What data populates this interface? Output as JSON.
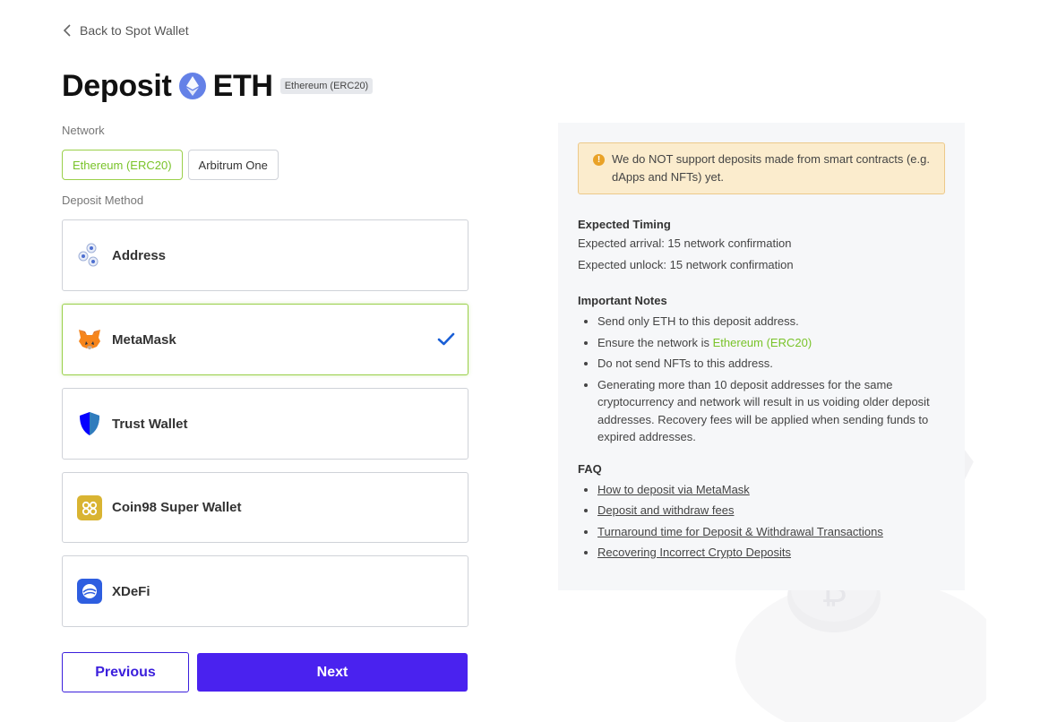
{
  "back": {
    "label": "Back to Spot Wallet"
  },
  "title": {
    "prefix": "Deposit",
    "coin": "ETH",
    "network_tag": "Ethereum (ERC20)"
  },
  "network": {
    "label": "Network",
    "options": [
      {
        "label": "Ethereum (ERC20)",
        "active": true
      },
      {
        "label": "Arbitrum One",
        "active": false
      }
    ]
  },
  "deposit_method": {
    "label": "Deposit Method",
    "options": [
      {
        "label": "Address",
        "icon": "address-icon",
        "selected": false
      },
      {
        "label": "MetaMask",
        "icon": "metamask-icon",
        "selected": true
      },
      {
        "label": "Trust Wallet",
        "icon": "trust-wallet-icon",
        "selected": false
      },
      {
        "label": "Coin98 Super Wallet",
        "icon": "coin98-icon",
        "selected": false
      },
      {
        "label": "XDeFi",
        "icon": "xdefi-icon",
        "selected": false
      }
    ]
  },
  "buttons": {
    "previous": "Previous",
    "next": "Next"
  },
  "info": {
    "warning": "We do NOT support deposits made from smart contracts (e.g. dApps and NFTs) yet.",
    "timing_heading": "Expected Timing",
    "arrival": "Expected arrival: 15 network confirmation",
    "unlock": "Expected unlock: 15 network confirmation",
    "notes_heading": "Important Notes",
    "notes": {
      "n1": "Send only ETH to this deposit address.",
      "n2_prefix": "Ensure the network is ",
      "n2_network": "Ethereum (ERC20)",
      "n3": "Do not send NFTs to this address.",
      "n4": "Generating more than 10 deposit addresses for the same cryptocurrency and network will result in us voiding older deposit addresses. Recovery fees will be applied when sending funds to expired addresses."
    },
    "faq_heading": "FAQ",
    "faq": [
      "How to deposit via MetaMask",
      "Deposit and withdraw fees",
      "Turnaround time for Deposit & Withdrawal Transactions",
      "Recovering Incorrect Crypto Deposits"
    ]
  },
  "colors": {
    "accent_purple": "#4a22ef",
    "active_green": "#79c329",
    "warning_bg": "#fbeccd",
    "eth_blue": "#6481e7"
  }
}
